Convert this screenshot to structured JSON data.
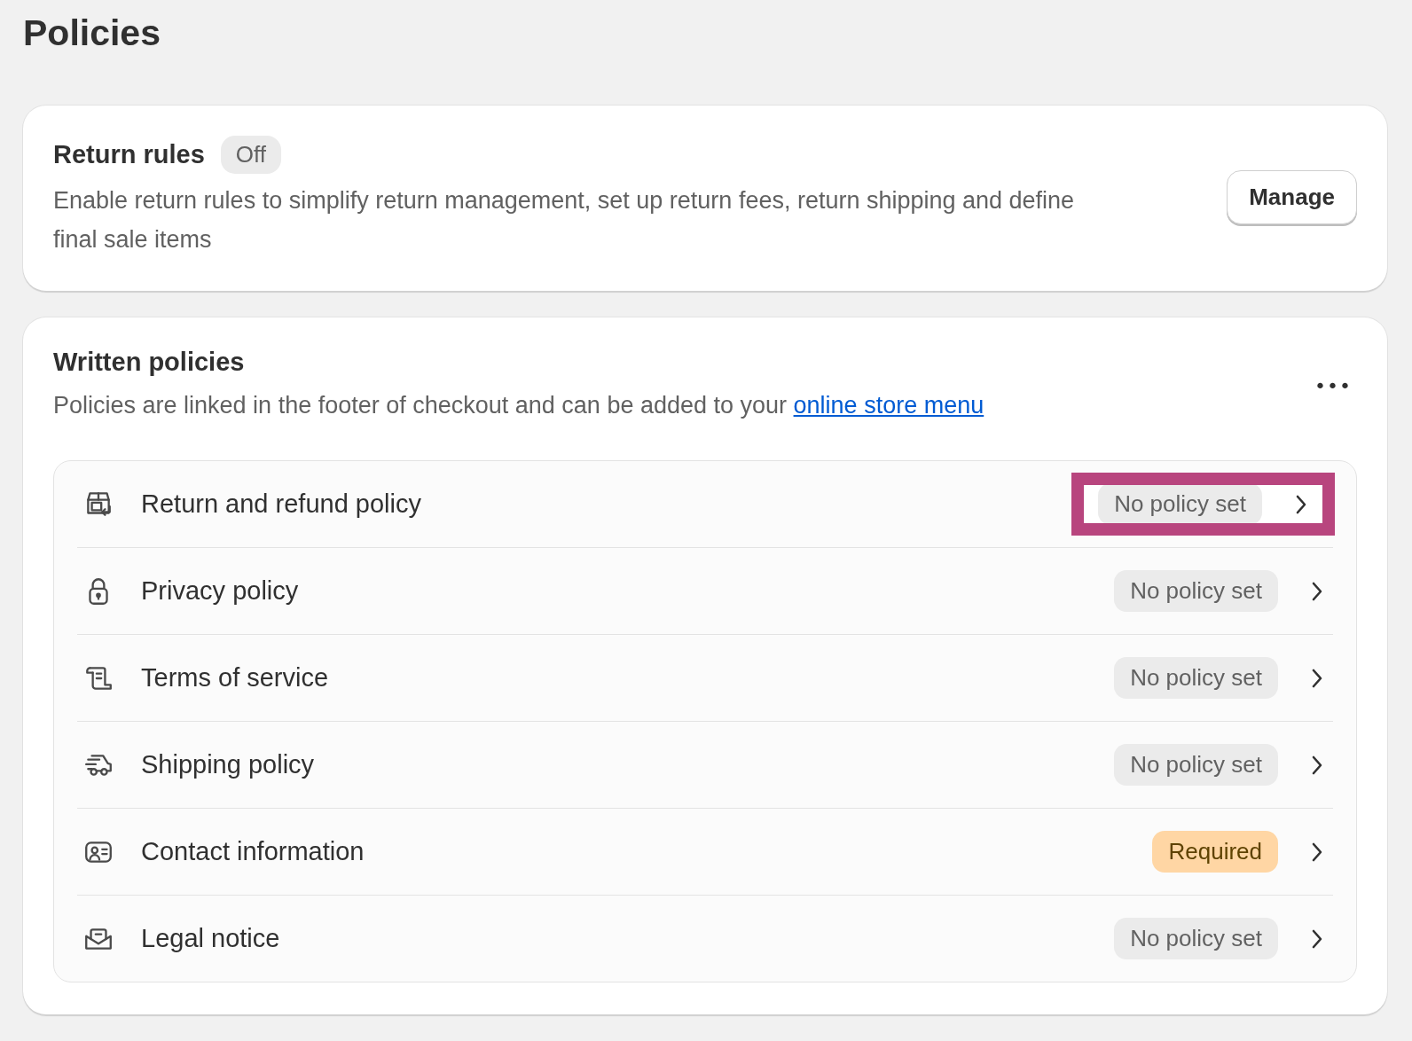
{
  "page_title": "Policies",
  "return_rules": {
    "title": "Return rules",
    "status": "Off",
    "description": "Enable return rules to simplify return management, set up return fees, return shipping and define final sale items",
    "button": "Manage"
  },
  "written_policies": {
    "title": "Written policies",
    "description_text": "Policies are linked in the footer of checkout and can be added to your",
    "link": "online store menu",
    "more_button": "•••",
    "policies": [
      {
        "label": "Return and refund policy",
        "badge": "No policy set",
        "kind": "neutral",
        "highlighted": true
      },
      {
        "label": "Privacy policy",
        "badge": "No policy set",
        "kind": "neutral",
        "highlighted": false
      },
      {
        "label": "Terms of service",
        "badge": "No policy set",
        "kind": "neutral",
        "highlighted": false
      },
      {
        "label": "Shipping policy",
        "badge": "No policy set",
        "kind": "neutral",
        "highlighted": false
      },
      {
        "label": "Contact information",
        "badge": "Required",
        "kind": "warning",
        "highlighted": false
      },
      {
        "label": "Legal notice",
        "badge": "No policy set",
        "kind": "neutral",
        "highlighted": false
      }
    ]
  }
}
